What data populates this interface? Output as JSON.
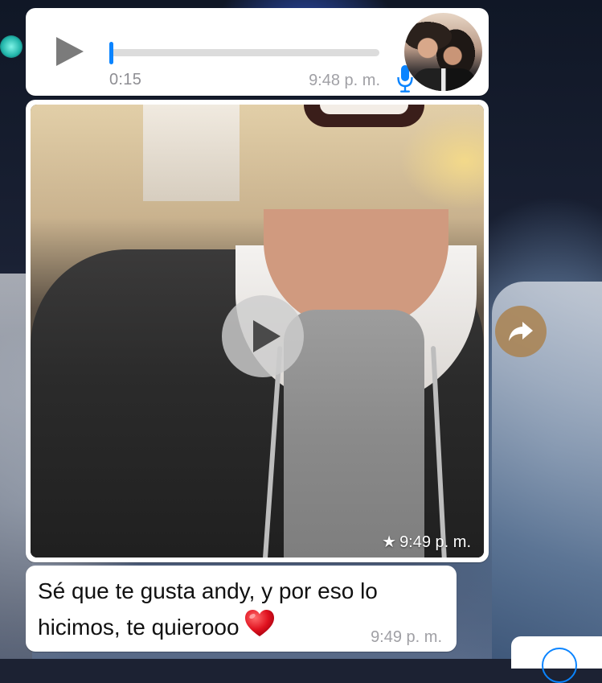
{
  "voice_note": {
    "duration": "0:15",
    "time": "9:48 p. m.",
    "progress": 0,
    "mic_icon": "microphone-icon",
    "accent_color": "#0a84ff"
  },
  "video_message": {
    "play_icon": "play-icon",
    "starred_icon": "★",
    "time": "9:49 p. m."
  },
  "share_button": {
    "icon": "forward-share-icon"
  },
  "text_message": {
    "body": "Sé que te gusta andy, y por eso lo hicimos, te quierooo",
    "emoji": "❤️",
    "time": "9:49 p. m."
  }
}
